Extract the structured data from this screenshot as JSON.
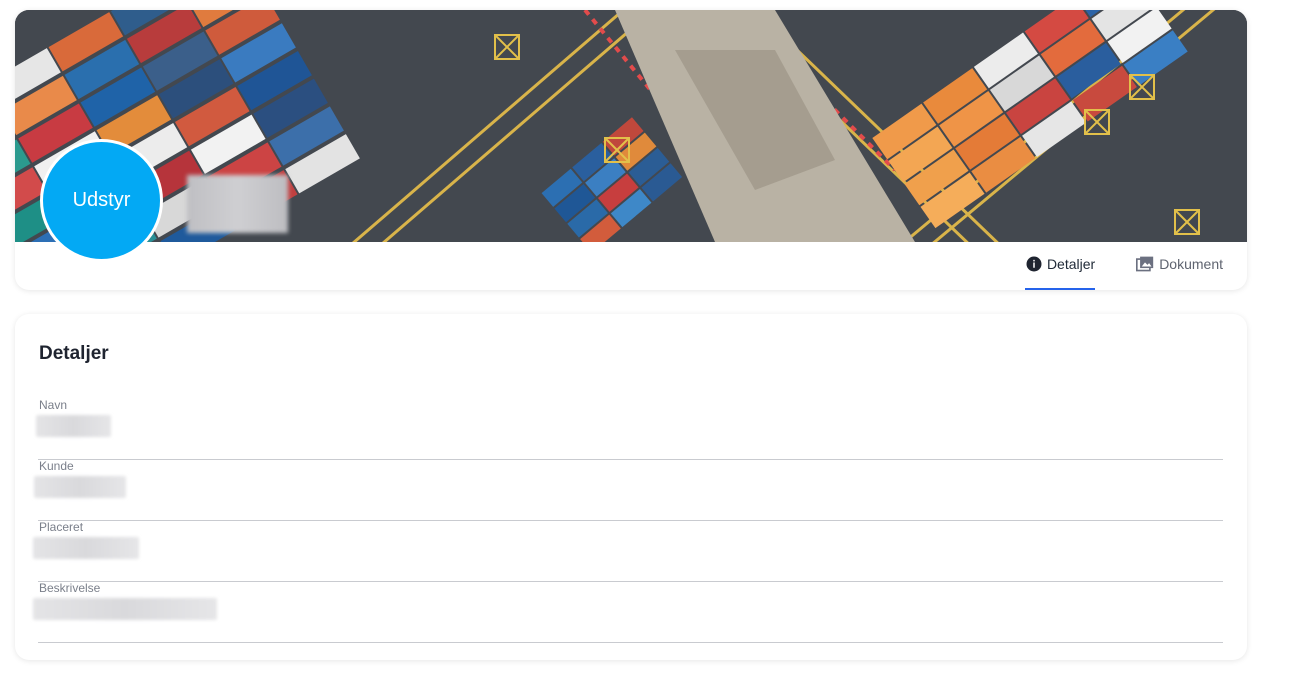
{
  "header": {
    "avatar_label": "Udstyr",
    "tabs": [
      {
        "label": "Detaljer",
        "icon": "info-circle-icon",
        "active": true
      },
      {
        "label": "Dokument",
        "icon": "photo-library-icon",
        "active": false
      }
    ]
  },
  "details": {
    "title": "Detaljer",
    "fields": [
      {
        "label": "Navn"
      },
      {
        "label": "Kunde"
      },
      {
        "label": "Placeret"
      },
      {
        "label": "Beskrivelse"
      }
    ]
  },
  "colors": {
    "accent": "#03a9f4",
    "tab_indicator": "#2563eb"
  }
}
